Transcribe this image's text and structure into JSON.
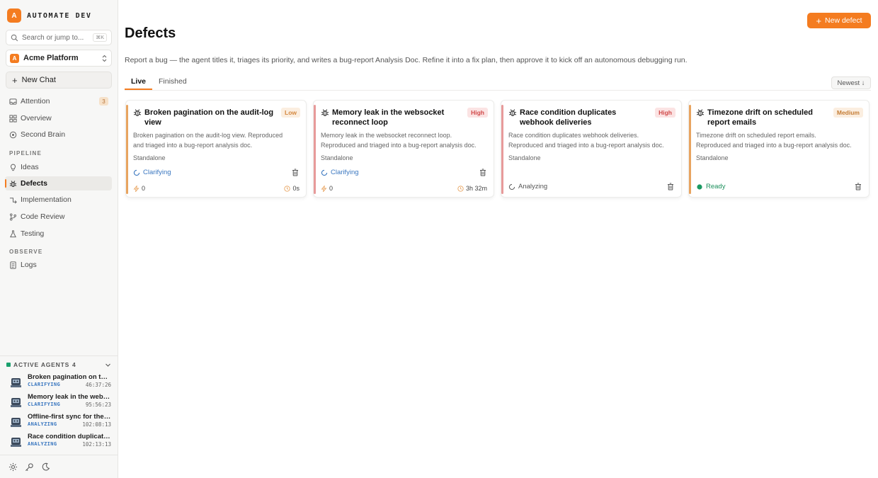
{
  "brand": {
    "logo_letter": "A",
    "name": "AUTOMATE DEV"
  },
  "search": {
    "placeholder": "Search or jump to...",
    "shortcut": "⌘K"
  },
  "project": {
    "logo_letter": "A",
    "name": "Acme Platform"
  },
  "new_chat": {
    "label": "New Chat"
  },
  "nav": {
    "main": [
      {
        "label": "Attention",
        "badge": "3",
        "icon": "inbox-icon"
      },
      {
        "label": "Overview",
        "icon": "grid-icon"
      },
      {
        "label": "Second Brain",
        "icon": "brain-icon"
      }
    ],
    "pipeline_label": "PIPELINE",
    "pipeline": [
      {
        "label": "Ideas",
        "icon": "lightbulb-icon"
      },
      {
        "label": "Defects",
        "icon": "bug-icon",
        "active": true
      },
      {
        "label": "Implementation",
        "icon": "flow-icon"
      },
      {
        "label": "Code Review",
        "icon": "branch-icon"
      },
      {
        "label": "Testing",
        "icon": "flask-icon"
      }
    ],
    "observe_label": "OBSERVE",
    "observe": [
      {
        "label": "Logs",
        "icon": "logs-icon"
      }
    ]
  },
  "active_agents": {
    "title": "ACTIVE AGENTS",
    "count": "4",
    "items": [
      {
        "title": "Broken pagination on the audit-log view",
        "status": "CLARIFYING",
        "time": "46:37:26"
      },
      {
        "title": "Memory leak in the websocket reconnect loop",
        "status": "CLARIFYING",
        "time": "95:56:23"
      },
      {
        "title": "Offline-first sync for the mobile app",
        "status": "ANALYZING",
        "time": "102:08:13"
      },
      {
        "title": "Race condition duplicates webhook deliveries",
        "status": "ANALYZING",
        "time": "102:13:13"
      }
    ]
  },
  "page": {
    "title": "Defects",
    "subtitle": "Report a bug — the agent titles it, triages its priority, and writes a bug-report Analysis Doc. Refine it into a fix plan, then approve it to kick off an autonomous debugging run.",
    "new_button": "New defect",
    "tabs": [
      "Live",
      "Finished"
    ],
    "sort": "Newest ↓"
  },
  "colors": {
    "accent": "#f47c20",
    "low": "#e8a460",
    "high": "#e79a9a",
    "medium": "#e8a460"
  },
  "cards": [
    {
      "title": "Broken pagination on the audit-log view",
      "priority": "Low",
      "desc_line1": "Broken pagination on the audit-log view. Reproduced",
      "desc_line2": "and triaged into a bug-report analysis doc.",
      "group": "Standalone",
      "status": "Clarifying",
      "count": "0",
      "elapsed": "0s"
    },
    {
      "title": "Memory leak in the websocket reconnect loop",
      "priority": "High",
      "desc_line1": "Memory leak in the websocket reconnect loop.",
      "desc_line2": "Reproduced and triaged into a bug-report analysis doc.",
      "group": "Standalone",
      "status": "Clarifying",
      "count": "0",
      "elapsed": "3h 32m"
    },
    {
      "title": "Race condition duplicates webhook deliveries",
      "priority": "High",
      "desc_line1": "Race condition duplicates webhook deliveries.",
      "desc_line2": "Reproduced and triaged into a bug-report analysis doc.",
      "group": "Standalone",
      "status": "Analyzing"
    },
    {
      "title": "Timezone drift on scheduled report emails",
      "priority": "Medium",
      "desc_line1": "Timezone drift on scheduled report emails.",
      "desc_line2": "Reproduced and triaged into a bug-report analysis doc.",
      "group": "Standalone",
      "status": "Ready"
    }
  ]
}
